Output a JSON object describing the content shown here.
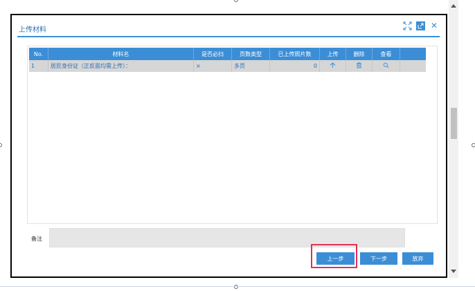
{
  "dialog": {
    "title": "上传材料",
    "icons": [
      "expand-icon",
      "popout-icon",
      "close-icon"
    ]
  },
  "table": {
    "headers": {
      "no": "No.",
      "name": "材料名",
      "required": "是否必扫",
      "page_type": "页数类型",
      "uploaded_count": "已上传照片数",
      "upload": "上传",
      "delete": "删除",
      "view": "查看"
    },
    "rows": [
      {
        "no": "1",
        "name": "居民身份证（正反面均需上传）：",
        "required": "×",
        "page_type": "多页",
        "uploaded_count": "0",
        "upload_icon": "upload-arrow-icon",
        "delete_icon": "trash-icon",
        "view_icon": "magnifier-icon"
      }
    ]
  },
  "remark": {
    "label": "备注",
    "value": ""
  },
  "buttons": {
    "prev": "上一步",
    "next": "下一步",
    "abandon": "放弃"
  },
  "colors": {
    "accent": "#3b8ed6",
    "highlight": "#e0305a"
  }
}
